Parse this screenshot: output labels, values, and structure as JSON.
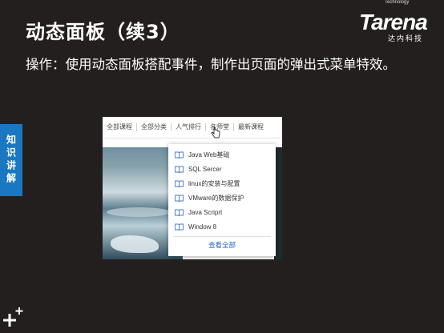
{
  "slide": {
    "title": "动态面板（续3）",
    "description": "操作：使用动态面板搭配事件，制作出页面的弹出式菜单特效。",
    "side_tab": "知识讲解"
  },
  "logo": {
    "small": "Technology",
    "main": "Tarena",
    "cn": "达内科技"
  },
  "nav": {
    "items": [
      "全部课程",
      "全部分类",
      "人气排行",
      "名师堂",
      "最新课程"
    ]
  },
  "dropdown": {
    "items": [
      "Java Web基础",
      "SQL Sercer",
      "linux的安装与配置",
      "VMware的数据保护",
      "Java Scriprt",
      "Window 8"
    ],
    "view_all": "查看全部"
  },
  "colors": {
    "background": "#231f1e",
    "side_tab": "#1a78c2",
    "link": "#2a63c9"
  }
}
